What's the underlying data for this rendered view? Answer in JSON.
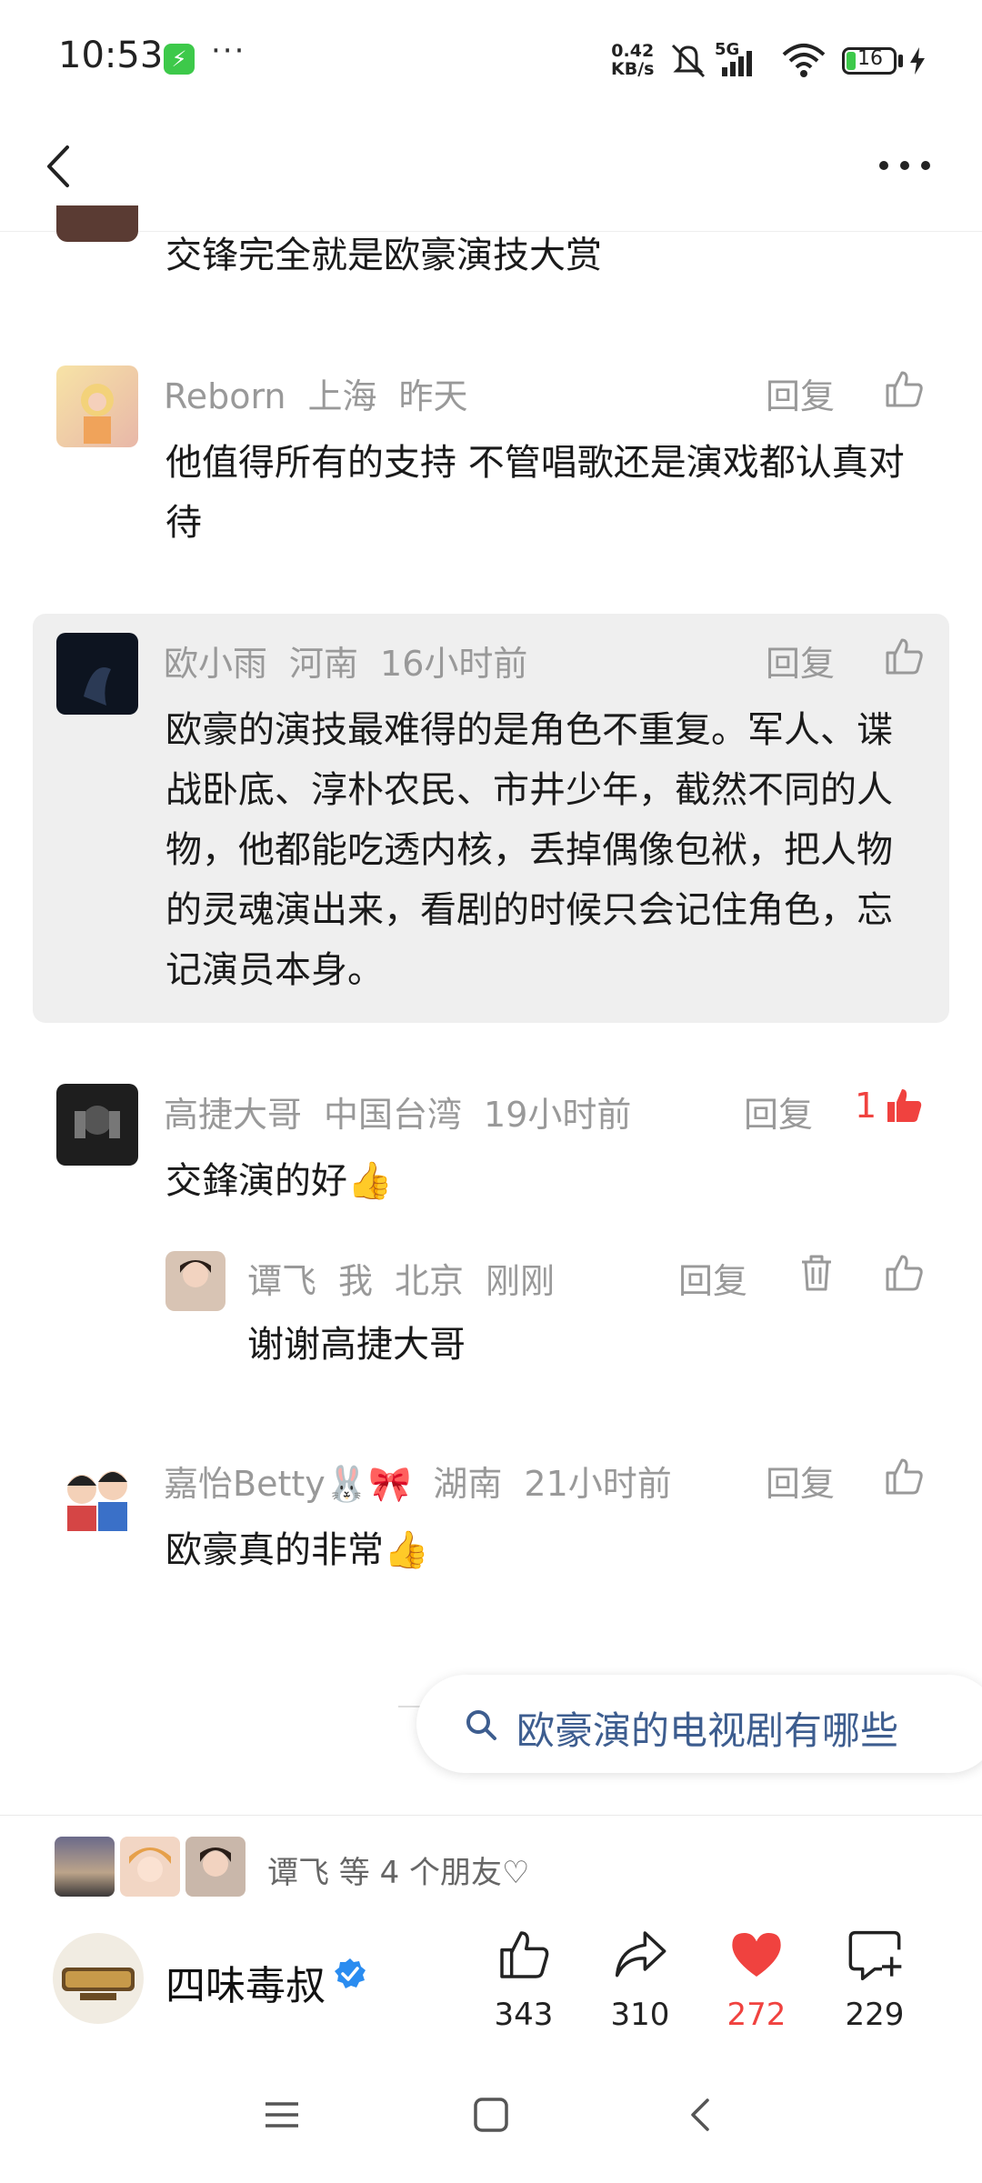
{
  "status_bar": {
    "time": "10:53",
    "dots": "···",
    "net_speed_value": "0.42",
    "net_speed_unit": "KB/s",
    "network": "5G",
    "battery": "16"
  },
  "comments": [
    {
      "text": "交锋完全就是欧豪演技大赏"
    },
    {
      "user": "Reborn",
      "location": "上海",
      "time": "昨天",
      "reply_label": "回复",
      "text": "他值得所有的支持 不管唱歌还是演戏都认真对待"
    },
    {
      "user": "欧小雨",
      "location": "河南",
      "time": "16小时前",
      "reply_label": "回复",
      "text": "欧豪的演技最难得的是角色不重复。军人、谍战卧底、淳朴农民、市井少年，截然不同的人物，他都能吃透内核，丢掉偶像包袱，把人物的灵魂演出来，看剧的时候只会记住角色，忘记演员本身。"
    },
    {
      "user": "高捷大哥",
      "location": "中国台湾",
      "time": "19小时前",
      "reply_label": "回复",
      "like_count": "1",
      "text": "交鋒演的好👍",
      "reply": {
        "user": "谭飞",
        "tag": "我",
        "location": "北京",
        "time": "刚刚",
        "reply_label": "回复",
        "text": "谢谢高捷大哥"
      }
    },
    {
      "user": "嘉怡Betty🐰🎀",
      "location": "湖南",
      "time": "21小时前",
      "reply_label": "回复",
      "text": "欧豪真的非常👍"
    }
  ],
  "search_suggestion": "欧豪演的电视剧有哪些",
  "friends": {
    "text": "谭飞 等 4 个朋友♡"
  },
  "author": {
    "name": "四味毒叔"
  },
  "actions": {
    "like_count": "343",
    "share_count": "310",
    "heart_count": "272",
    "comment_count": "229"
  },
  "colors": {
    "accent_red": "#f0423f",
    "link_blue": "#3d5d8f",
    "verified_blue": "#2a8cf0"
  }
}
